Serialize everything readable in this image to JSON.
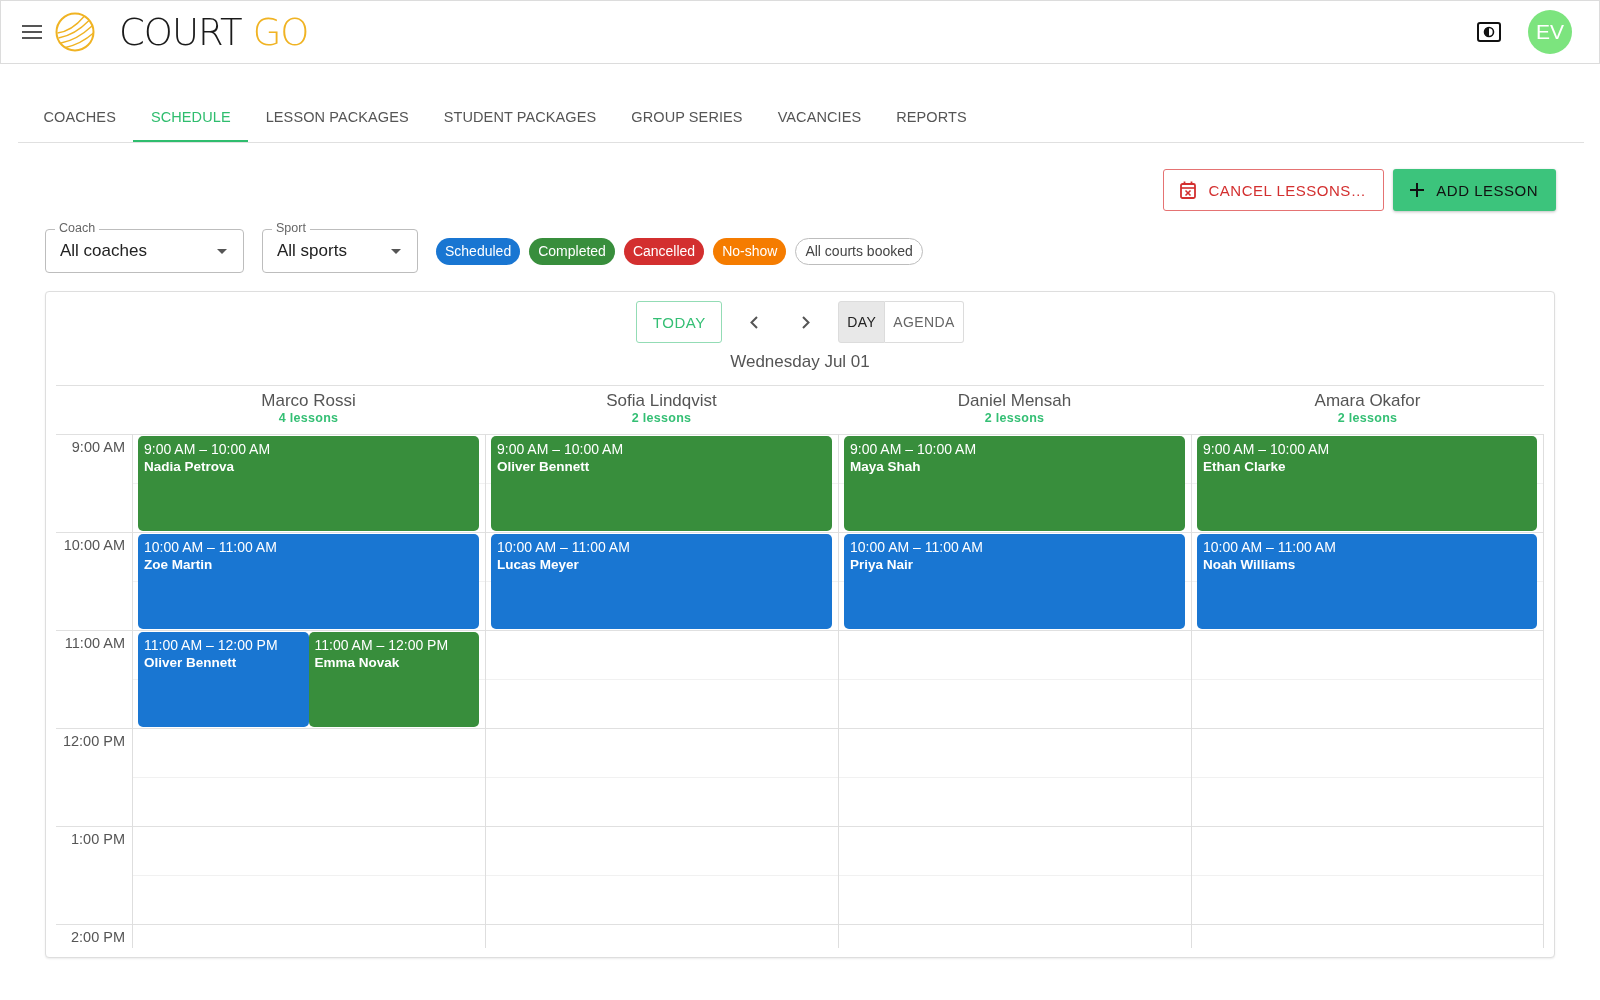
{
  "header": {
    "logo_text": "COURT",
    "logo_accent": "GO",
    "avatar_initials": "EV"
  },
  "tabs": [
    {
      "label": "COACHES",
      "selected": false
    },
    {
      "label": "SCHEDULE",
      "selected": true
    },
    {
      "label": "LESSON PACKAGES",
      "selected": false
    },
    {
      "label": "STUDENT PACKAGES",
      "selected": false
    },
    {
      "label": "GROUP SERIES",
      "selected": false
    },
    {
      "label": "VACANCIES",
      "selected": false
    },
    {
      "label": "REPORTS",
      "selected": false
    }
  ],
  "actions": [
    {
      "kind": "cancel",
      "label": "CANCEL LESSONS…"
    },
    {
      "kind": "add",
      "label": "ADD LESSON"
    }
  ],
  "filters": [
    {
      "label": "Coach",
      "value": "All coaches"
    },
    {
      "label": "Sport",
      "value": "All sports"
    }
  ],
  "legend": [
    {
      "label": "Scheduled",
      "kind": "filled",
      "color": "#1976d2"
    },
    {
      "label": "Completed",
      "kind": "filled",
      "color": "#388e3c"
    },
    {
      "label": "Cancelled",
      "kind": "filled",
      "color": "#d32f2f"
    },
    {
      "label": "No-show",
      "kind": "filled",
      "color": "#f57c00"
    },
    {
      "label": "All courts booked",
      "kind": "outlined"
    }
  ],
  "calendar": {
    "today_button": "TODAY",
    "views": [
      {
        "label": "DAY",
        "selected": true
      },
      {
        "label": "AGENDA",
        "selected": false
      }
    ],
    "date": "Wednesday Jul 01",
    "times": [
      "9:00 AM",
      "10:00 AM",
      "11:00 AM",
      "12:00 PM",
      "1:00 PM",
      "2:00 PM"
    ],
    "coaches": [
      {
        "name": "Marco Rossi",
        "count": "4 lessons",
        "slots": [
          {
            "lessons": [
              {
                "time": "9:00 AM – 10:00 AM",
                "student": "Nadia Petrova",
                "color": "#388e3c"
              }
            ]
          },
          {
            "lessons": [
              {
                "time": "10:00 AM – 11:00 AM",
                "student": "Zoe Martin",
                "color": "#1976d2"
              }
            ]
          },
          {
            "lessons": [
              {
                "time": "11:00 AM – 12:00 PM",
                "student": "Oliver Bennett",
                "color": "#1976d2"
              },
              {
                "time": "11:00 AM – 12:00 PM",
                "student": "Emma Novak",
                "color": "#388e3c"
              }
            ]
          }
        ]
      },
      {
        "name": "Sofia Lindqvist",
        "count": "2 lessons",
        "slots": [
          {
            "lessons": [
              {
                "time": "9:00 AM – 10:00 AM",
                "student": "Oliver Bennett",
                "color": "#388e3c"
              }
            ]
          },
          {
            "lessons": [
              {
                "time": "10:00 AM – 11:00 AM",
                "student": "Lucas Meyer",
                "color": "#1976d2"
              }
            ]
          }
        ]
      },
      {
        "name": "Daniel Mensah",
        "count": "2 lessons",
        "slots": [
          {
            "lessons": [
              {
                "time": "9:00 AM – 10:00 AM",
                "student": "Maya Shah",
                "color": "#388e3c"
              }
            ]
          },
          {
            "lessons": [
              {
                "time": "10:00 AM – 11:00 AM",
                "student": "Priya Nair",
                "color": "#1976d2"
              }
            ]
          }
        ]
      },
      {
        "name": "Amara Okafor",
        "count": "2 lessons",
        "slots": [
          {
            "lessons": [
              {
                "time": "9:00 AM – 10:00 AM",
                "student": "Ethan Clarke",
                "color": "#388e3c"
              }
            ]
          },
          {
            "lessons": [
              {
                "time": "10:00 AM – 11:00 AM",
                "student": "Noah Williams",
                "color": "#1976d2"
              }
            ]
          }
        ]
      }
    ]
  }
}
